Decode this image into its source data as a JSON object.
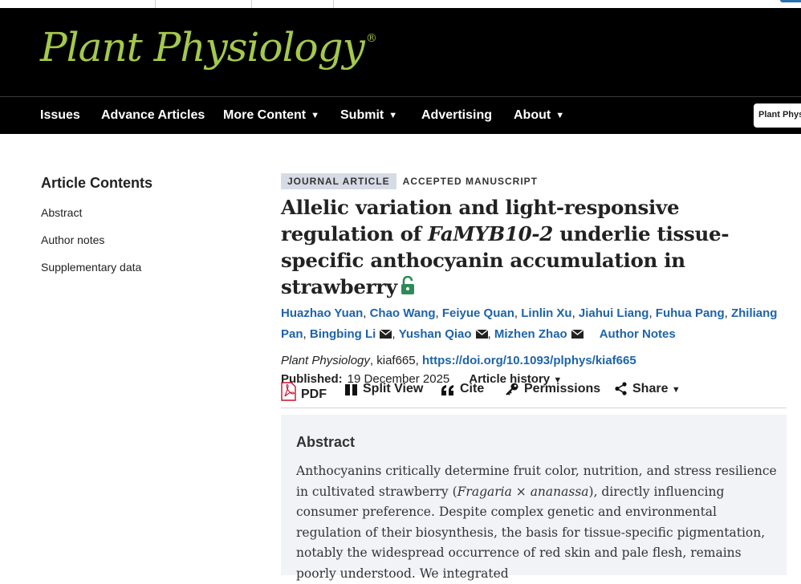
{
  "masthead": {
    "logo_text": "Plant Physiology",
    "logo_mark": "®",
    "logo_color": "#a4c94a"
  },
  "nav": {
    "items": [
      {
        "label": "Issues",
        "dropdown": false
      },
      {
        "label": "Advance Articles",
        "dropdown": false
      },
      {
        "label": "More Content",
        "dropdown": true
      },
      {
        "label": "Submit",
        "dropdown": true
      },
      {
        "label": "Advertising",
        "dropdown": false
      },
      {
        "label": "About",
        "dropdown": true
      }
    ],
    "search_scope": "Plant Phys",
    "caret": "▼"
  },
  "sidebar": {
    "title": "Article Contents",
    "items": [
      "Abstract",
      "Author notes",
      "Supplementary data"
    ]
  },
  "article": {
    "type_badge": "JOURNAL ARTICLE",
    "status_badge": "ACCEPTED MANUSCRIPT",
    "title_part1": "Allelic variation and light-responsive regulation of ",
    "title_gene": "FaMYB10-2",
    "title_part2": " underlie tissue-specific anthocyanin accumulation in strawberry",
    "authors": [
      "Huazhao Yuan",
      "Chao Wang",
      "Feiyue Quan",
      "Linlin Xu",
      "Jiahui Liang",
      "Fuhua Pang",
      "Zhiliang Pan",
      "Bingbing Li",
      "Yushan Qiao",
      "Mizhen Zhao"
    ],
    "author_notes": "Author Notes",
    "journal": "Plant Physiology",
    "article_id": ", kiaf665, ",
    "doi": "https://doi.org/10.1093/plphys/kiaf665",
    "published_label": "Published:",
    "published_date": "19 December 2025",
    "history_label": "Article history",
    "open_access_color": "#2e8b57",
    "link_color": "#1f64a8"
  },
  "toolbar": {
    "pdf": "PDF",
    "split_view": "Split View",
    "cite": "Cite",
    "permissions": "Permissions",
    "share": "Share"
  },
  "abstract": {
    "heading": "Abstract",
    "text_before_species": "Anthocyanins critically determine fruit color, nutrition, and stress resilience in cultivated strawberry (",
    "species": "Fragaria × ananassa",
    "text_after_species": "), directly influencing consumer preference. Despite complex genetic and environmental regulation of their biosynthesis, the basis for tissue-specific pigmentation, notably the widespread occurrence of red skin and pale flesh, remains poorly understood. We integrated"
  }
}
